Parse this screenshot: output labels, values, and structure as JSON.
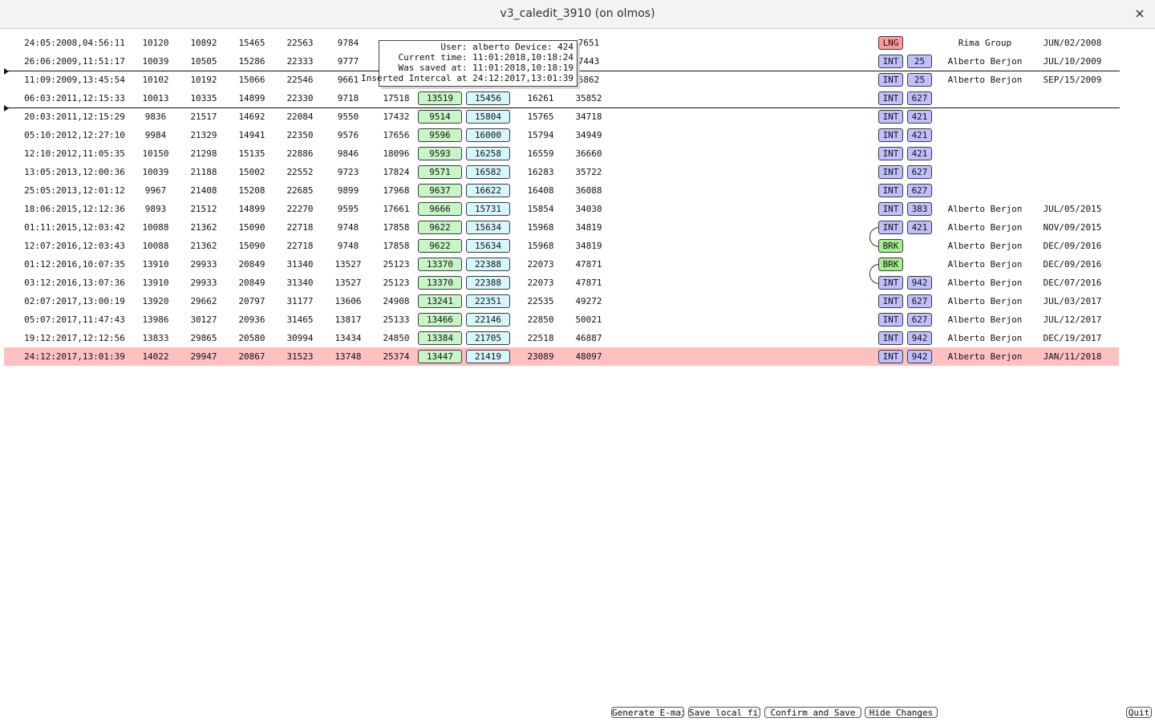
{
  "window": {
    "title": "v3_caledit_3910 (on olmos)",
    "close_glyph": "×"
  },
  "tooltip": {
    "user_line": "User: alberto Device: 424",
    "current_time_line": "Current time: 11:01:2018,10:18:24",
    "saved_line": "Was saved at: 11:01:2018,10:18:19",
    "inserted_line": "Inserted Intercal at 24:12:2017,13:01:39"
  },
  "rows": [
    {
      "date": "24:05:2008,04:56:11",
      "v1": "10120",
      "v2": "10892",
      "v3": "15465",
      "v4": "22563",
      "v5": "9784",
      "v6": "",
      "g": "",
      "c": "",
      "v7": "",
      "v8": "7651",
      "type": "LNG",
      "code": "",
      "who": "Rima Group",
      "when": "JUN/02/2008"
    },
    {
      "date": "26:06:2009,11:51:17",
      "v1": "10039",
      "v2": "10505",
      "v3": "15286",
      "v4": "22333",
      "v5": "9777",
      "v6": "",
      "g": "",
      "c": "",
      "v7": "",
      "v8": "7443",
      "type": "INT",
      "code": "25",
      "who": "Alberto Berjon",
      "when": "JUL/10/2009"
    },
    {
      "date": "11:09:2009,13:45:54",
      "v1": "10102",
      "v2": "10192",
      "v3": "15066",
      "v4": "22546",
      "v5": "9661",
      "v6": "",
      "g": "",
      "c": "",
      "v7": "",
      "v8": "5862",
      "type": "INT",
      "code": "25",
      "who": "Alberto Berjon",
      "when": "SEP/15/2009"
    },
    {
      "date": "06:03:2011,12:15:33",
      "v1": "10013",
      "v2": "10335",
      "v3": "14899",
      "v4": "22330",
      "v5": "9718",
      "v6": "17518",
      "g": "13519",
      "c": "15456",
      "v7": "16261",
      "v8": "35852",
      "type": "INT",
      "code": "627",
      "who": "",
      "when": ""
    },
    {
      "date": "20:03:2011,12:15:29",
      "v1": "9836",
      "v2": "21517",
      "v3": "14692",
      "v4": "22084",
      "v5": "9550",
      "v6": "17432",
      "g": "9514",
      "c": "15804",
      "v7": "15765",
      "v8": "34718",
      "type": "INT",
      "code": "421",
      "who": "",
      "when": ""
    },
    {
      "date": "05:10:2012,12:27:10",
      "v1": "9984",
      "v2": "21329",
      "v3": "14941",
      "v4": "22350",
      "v5": "9576",
      "v6": "17656",
      "g": "9596",
      "c": "16000",
      "v7": "15794",
      "v8": "34949",
      "type": "INT",
      "code": "421",
      "who": "",
      "when": ""
    },
    {
      "date": "12:10:2012,11:05:35",
      "v1": "10150",
      "v2": "21298",
      "v3": "15135",
      "v4": "22886",
      "v5": "9846",
      "v6": "18096",
      "g": "9593",
      "c": "16258",
      "v7": "16559",
      "v8": "36660",
      "type": "INT",
      "code": "421",
      "who": "",
      "when": ""
    },
    {
      "date": "13:05:2013,12:00:36",
      "v1": "10039",
      "v2": "21188",
      "v3": "15002",
      "v4": "22552",
      "v5": "9723",
      "v6": "17824",
      "g": "9571",
      "c": "16582",
      "v7": "16283",
      "v8": "35722",
      "type": "INT",
      "code": "627",
      "who": "",
      "when": ""
    },
    {
      "date": "25:05:2013,12:01:12",
      "v1": "9967",
      "v2": "21408",
      "v3": "15208",
      "v4": "22685",
      "v5": "9899",
      "v6": "17968",
      "g": "9637",
      "c": "16622",
      "v7": "16408",
      "v8": "36088",
      "type": "INT",
      "code": "627",
      "who": "",
      "when": ""
    },
    {
      "date": "18:06:2015,12:12:36",
      "v1": "9893",
      "v2": "21512",
      "v3": "14899",
      "v4": "22270",
      "v5": "9595",
      "v6": "17661",
      "g": "9666",
      "c": "15731",
      "v7": "15854",
      "v8": "34030",
      "type": "INT",
      "code": "383",
      "who": "Alberto Berjon",
      "when": "JUL/05/2015"
    },
    {
      "date": "01:11:2015,12:03:42",
      "v1": "10088",
      "v2": "21362",
      "v3": "15090",
      "v4": "22718",
      "v5": "9748",
      "v6": "17858",
      "g": "9622",
      "c": "15634",
      "v7": "15968",
      "v8": "34819",
      "type": "INT",
      "code": "421",
      "who": "Alberto Berjon",
      "when": "NOV/09/2015"
    },
    {
      "date": "12:07:2016,12:03:43",
      "v1": "10088",
      "v2": "21362",
      "v3": "15090",
      "v4": "22718",
      "v5": "9748",
      "v6": "17858",
      "g": "9622",
      "c": "15634",
      "v7": "15968",
      "v8": "34819",
      "type": "BRK",
      "code": "",
      "who": "Alberto Berjon",
      "when": "DEC/09/2016"
    },
    {
      "date": "01:12:2016,10:07:35",
      "v1": "13910",
      "v2": "29933",
      "v3": "20849",
      "v4": "31340",
      "v5": "13527",
      "v6": "25123",
      "g": "13370",
      "c": "22388",
      "v7": "22073",
      "v8": "47871",
      "type": "BRK",
      "code": "",
      "who": "Alberto Berjon",
      "when": "DEC/09/2016"
    },
    {
      "date": "03:12:2016,13:07:36",
      "v1": "13910",
      "v2": "29933",
      "v3": "20849",
      "v4": "31340",
      "v5": "13527",
      "v6": "25123",
      "g": "13370",
      "c": "22388",
      "v7": "22073",
      "v8": "47871",
      "type": "INT",
      "code": "942",
      "who": "Alberto Berjon",
      "when": "DEC/07/2016"
    },
    {
      "date": "02:07:2017,13:00:19",
      "v1": "13920",
      "v2": "29662",
      "v3": "20797",
      "v4": "31177",
      "v5": "13606",
      "v6": "24908",
      "g": "13241",
      "c": "22351",
      "v7": "22535",
      "v8": "49272",
      "type": "INT",
      "code": "627",
      "who": "Alberto Berjon",
      "when": "JUL/03/2017"
    },
    {
      "date": "05:07:2017,11:47:43",
      "v1": "13986",
      "v2": "30127",
      "v3": "20936",
      "v4": "31465",
      "v5": "13817",
      "v6": "25133",
      "g": "13466",
      "c": "22146",
      "v7": "22850",
      "v8": "50021",
      "type": "INT",
      "code": "627",
      "who": "Alberto Berjon",
      "when": "JUL/12/2017"
    },
    {
      "date": "19:12:2017,12:12:56",
      "v1": "13833",
      "v2": "29865",
      "v3": "20580",
      "v4": "30994",
      "v5": "13434",
      "v6": "24850",
      "g": "13384",
      "c": "21705",
      "v7": "22518",
      "v8": "46887",
      "type": "INT",
      "code": "942",
      "who": "Alberto Berjon",
      "when": "DEC/19/2017"
    },
    {
      "date": "24:12:2017,13:01:39",
      "v1": "14022",
      "v2": "29947",
      "v3": "20867",
      "v4": "31523",
      "v5": "13748",
      "v6": "25374",
      "g": "13447",
      "c": "21419",
      "v7": "23089",
      "v8": "48097",
      "type": "INT",
      "code": "942",
      "who": "Alberto Berjon",
      "when": "JAN/11/2018",
      "selected": true
    }
  ],
  "buttons": {
    "email": "Generate E-mail",
    "save_local": "Save local file",
    "confirm": "Confirm and Save",
    "hide": "Hide Changes",
    "quit": "Quit"
  },
  "colors": {
    "selected_row": "#ffc0c0",
    "green_box": "#c8f4c8",
    "cyan_box": "#d6f6fb",
    "int_tag": "#c0c0ff",
    "lng_tag": "#ff9a9a",
    "brk_tag": "#a8ec94"
  }
}
